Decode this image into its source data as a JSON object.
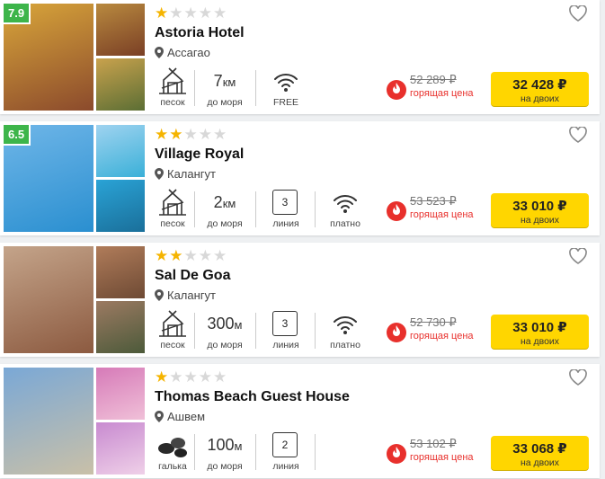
{
  "hotels": [
    {
      "rating": "7.9",
      "stars": 1,
      "name": "Astoria Hotel",
      "location": "Ассагао",
      "beach": "песок",
      "distance_value": "7",
      "distance_unit": "км",
      "distance_label": "до моря",
      "third_type": "none",
      "line_value": "",
      "line_label": "",
      "wifi_label": "FREE",
      "old_price": "52 289 ₽",
      "hot_label": "горящая цена",
      "price": "32 428 ₽",
      "price_note": "на двоих"
    },
    {
      "rating": "6.5",
      "stars": 2,
      "name": "Village Royal",
      "location": "Калангут",
      "beach": "песок",
      "distance_value": "2",
      "distance_unit": "км",
      "distance_label": "до моря",
      "third_type": "line",
      "line_value": "3",
      "line_label": "линия",
      "wifi_label": "платно",
      "old_price": "53 523 ₽",
      "hot_label": "горящая цена",
      "price": "33 010 ₽",
      "price_note": "на двоих"
    },
    {
      "rating": "",
      "stars": 2,
      "name": "Sal De Goa",
      "location": "Калангут",
      "beach": "песок",
      "distance_value": "300",
      "distance_unit": "м",
      "distance_label": "до моря",
      "third_type": "line",
      "line_value": "3",
      "line_label": "линия",
      "wifi_label": "платно",
      "old_price": "52 730 ₽",
      "hot_label": "горящая цена",
      "price": "33 010 ₽",
      "price_note": "на двоих"
    },
    {
      "rating": "",
      "stars": 1,
      "name": "Thomas Beach Guest House",
      "location": "Ашвем",
      "beach": "галька",
      "distance_value": "100",
      "distance_unit": "м",
      "distance_label": "до моря",
      "third_type": "line",
      "line_value": "2",
      "line_label": "линия",
      "wifi_label": "",
      "old_price": "53 102 ₽",
      "hot_label": "горящая цена",
      "price": "33 068 ₽",
      "price_note": "на двоих"
    }
  ],
  "colors": {
    "star": "#f5b400",
    "rating_badge": "#3db54a",
    "hot": "#e8302c",
    "buy_button": "#ffd600"
  }
}
